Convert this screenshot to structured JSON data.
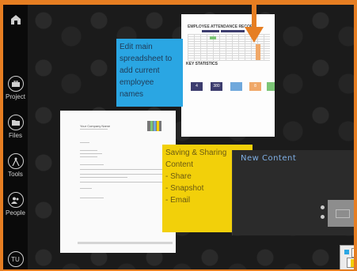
{
  "sidebar": {
    "home_icon": "home-icon",
    "items": [
      {
        "label": "Project",
        "icon": "briefcase-icon"
      },
      {
        "label": "Files",
        "icon": "folder-icon"
      },
      {
        "label": "Tools",
        "icon": "compass-icon"
      },
      {
        "label": "People",
        "icon": "people-icon"
      }
    ],
    "avatar_initials": "TU"
  },
  "spreadsheet_doc": {
    "title": "EMPLOYEE ATTENDANCE RECORD",
    "kpi_title": "KEY STATISTICS",
    "kpi_values": [
      "4",
      "380",
      "",
      "8",
      ""
    ]
  },
  "letter_doc": {
    "heading": "Your Company Name"
  },
  "notes": {
    "blue": "Edit main spreadsheet to add current employee names",
    "yellow_lines": [
      "Saving & Sharing Content",
      "- Share",
      "- Snapshot",
      "- Email"
    ]
  },
  "new_content": {
    "title": "New Content"
  },
  "colors": {
    "accent": "#e67e22",
    "blue_note": "#2aa6e3",
    "yellow_note": "#f2d00a"
  }
}
